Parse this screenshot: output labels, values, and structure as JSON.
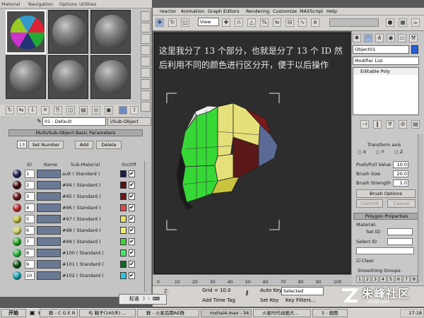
{
  "material_editor": {
    "menu": [
      "Material",
      "Navigation",
      "Options",
      "Utilities"
    ],
    "material_name": "01 - Default",
    "material_type": "i/Sub-Object",
    "rollout_title": "Multi/Sub-Object Basic Parameters",
    "count": "13",
    "set_number": "Set Number",
    "add": "Add",
    "delete": "Delete",
    "headers": {
      "id": "ID",
      "name": "Name",
      "sub": "Sub-Material",
      "onoff": "On/Off"
    },
    "rows": [
      {
        "id": "1",
        "sub": "ault   ( Standard )",
        "color": "#1a1f4a",
        "sphere": "#222a55"
      },
      {
        "id": "2",
        "sub": "#94   ( Standard )",
        "color": "#5a1010",
        "sphere": "#4a1010"
      },
      {
        "id": "3",
        "sub": "#95   ( Standard )",
        "color": "#6a1818",
        "sphere": "#6a1a1a"
      },
      {
        "id": "4",
        "sub": "#96   ( Standard )",
        "color": "#e04848",
        "sphere": "#c43030"
      },
      {
        "id": "5",
        "sub": "#97   ( Standard )",
        "color": "#e8e060",
        "sphere": "#c8c440"
      },
      {
        "id": "6",
        "sub": "#98   ( Standard )",
        "color": "#f0f078",
        "sphere": "#d8d860"
      },
      {
        "id": "7",
        "sub": "#99   ( Standard )",
        "color": "#38d838",
        "sphere": "#28b028"
      },
      {
        "id": "8",
        "sub": "#100   ( Standard )",
        "color": "#48e868",
        "sphere": "#30c040"
      },
      {
        "id": "9",
        "sub": "#101   ( Standard )",
        "color": "#106a20",
        "sphere": "#0e5a1c"
      },
      {
        "id": "10",
        "sub": "#102   ( Standard )",
        "color": "#28c8d8",
        "sphere": "#1aa8b8"
      }
    ]
  },
  "main_menu": [
    "reactor",
    "Animation",
    "Graph Editors",
    "Rendering",
    "Customize",
    "MAXScript",
    "Help"
  ],
  "view_dropdown": "View",
  "caption": "这里我分了 13 个部分，也就是分了 13 个 ID 然后利用不同的颜色进行区分开，便于以后操作",
  "command_panel": {
    "object_name": "Object01",
    "modifier_list": "Modifier List",
    "stack_item": "Editable Poly",
    "transform_axis": "Transform axis",
    "axes": [
      "X",
      "Y",
      "Z"
    ],
    "push_pull_label": "Push/Pull Value",
    "push_pull_value": "10.0",
    "brush_size_label": "Brush Size",
    "brush_size_value": "20.0",
    "brush_strength_label": "Brush Strength",
    "brush_strength_value": "1.0",
    "brush_options": "Brush Options",
    "commit": "Commit",
    "cancel": "Cancel",
    "polygon_properties": "Polygon Properties",
    "material_label": "Material:",
    "set_id": "Set ID:",
    "select_id": "Select ID",
    "clear": "Clear",
    "smoothing_groups": "Smoothing Groups:",
    "sg_numbers": [
      "1",
      "2",
      "3",
      "4",
      "5",
      "6",
      "7",
      "8"
    ]
  },
  "status": {
    "timeline_ticks": [
      "0",
      "10",
      "20",
      "30",
      "40",
      "50",
      "60",
      "70",
      "80",
      "90",
      "100"
    ],
    "z_label": "Z:",
    "grid": "Grid = 10.0",
    "add_time_tag": "Add Time Tag",
    "auto_key": "Auto Key",
    "selected": "Selected",
    "set_key": "Set Key",
    "key_filters": "Key Filters...",
    "ime": "标准"
  },
  "watermark": {
    "name": "朱峰社区",
    "url": "ZF3D.com"
  },
  "taskbar": {
    "start": "开始",
    "tasks": [
      "群 - C G E R 0...",
      "与 鞋子(140天) ...",
      "群 - 火星后期AE群",
      "mxhai4.max - 34...",
      "火星时代动画大...",
      "5 - 画图"
    ],
    "clock": "17:18"
  }
}
